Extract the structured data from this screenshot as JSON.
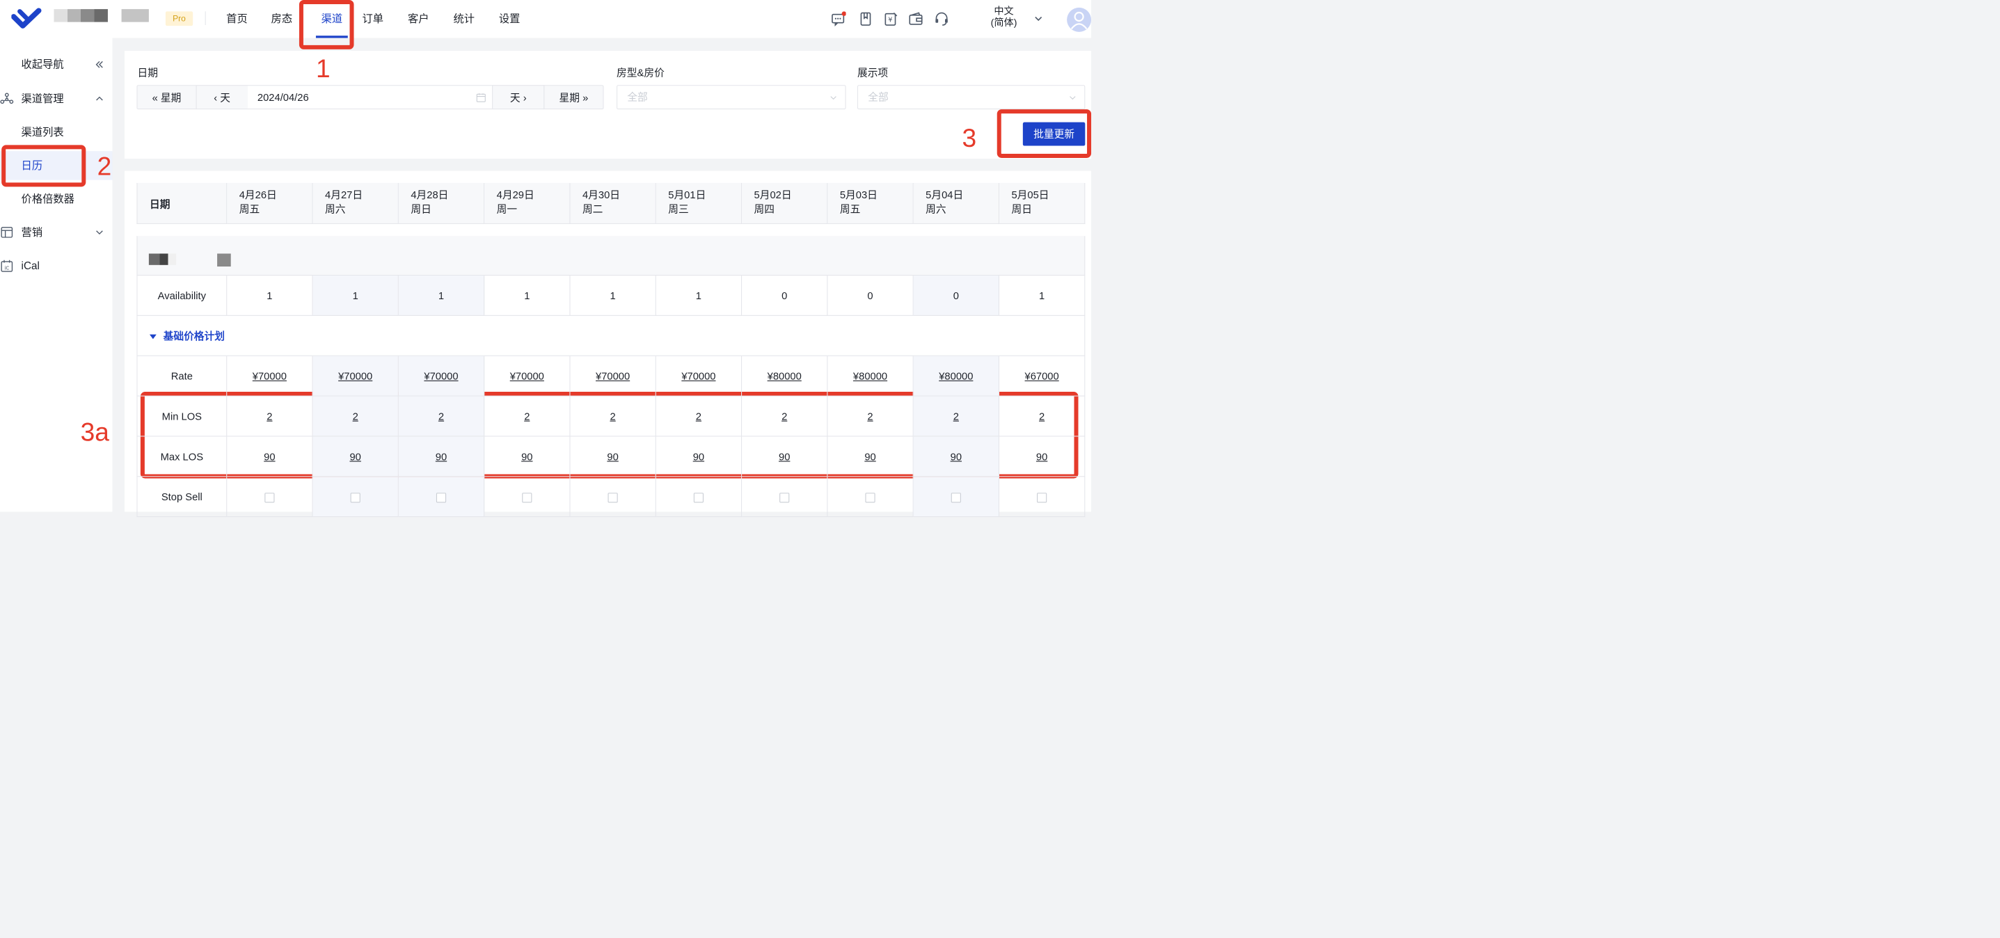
{
  "header": {
    "pro_badge": "Pro",
    "nav": [
      "首页",
      "房态",
      "渠道",
      "订单",
      "客户",
      "统计",
      "设置"
    ],
    "active_nav": "渠道",
    "lang_line1": "中文",
    "lang_line2": "(简体)"
  },
  "sidebar": {
    "collapse": "收起导航",
    "channel_mgmt": "渠道管理",
    "channel_list": "渠道列表",
    "calendar": "日历",
    "price_multiplier": "价格倍数器",
    "marketing": "营销",
    "ical": "iCal"
  },
  "filter": {
    "date_label": "日期",
    "prev_week": "星期",
    "prev_day": "天",
    "date_value": "2024/04/26",
    "next_day": "天",
    "next_week": "星期",
    "room_label": "房型&房价",
    "room_placeholder": "全部",
    "display_label": "展示项",
    "display_placeholder": "全部",
    "bulk_update": "批量更新"
  },
  "table": {
    "date_header": "日期",
    "columns": [
      {
        "date": "4月26日",
        "weekday": "周五"
      },
      {
        "date": "4月27日",
        "weekday": "周六"
      },
      {
        "date": "4月28日",
        "weekday": "周日"
      },
      {
        "date": "4月29日",
        "weekday": "周一"
      },
      {
        "date": "4月30日",
        "weekday": "周二"
      },
      {
        "date": "5月01日",
        "weekday": "周三"
      },
      {
        "date": "5月02日",
        "weekday": "周四"
      },
      {
        "date": "5月03日",
        "weekday": "周五"
      },
      {
        "date": "5月04日",
        "weekday": "周六"
      },
      {
        "date": "5月05日",
        "weekday": "周日"
      }
    ],
    "availability_label": "Availability",
    "availability": [
      "1",
      "1",
      "1",
      "1",
      "1",
      "1",
      "0",
      "0",
      "0",
      "1"
    ],
    "plan_name": "基础价格计划",
    "rate_label": "Rate",
    "rates": [
      "¥70000",
      "¥70000",
      "¥70000",
      "¥70000",
      "¥70000",
      "¥70000",
      "¥80000",
      "¥80000",
      "¥80000",
      "¥67000"
    ],
    "min_los_label": "Min LOS",
    "min_los": [
      "2",
      "2",
      "2",
      "2",
      "2",
      "2",
      "2",
      "2",
      "2",
      "2"
    ],
    "max_los_label": "Max LOS",
    "max_los": [
      "90",
      "90",
      "90",
      "90",
      "90",
      "90",
      "90",
      "90",
      "90",
      "90"
    ],
    "stop_sell_label": "Stop Sell"
  },
  "annotations": {
    "step1": "1",
    "step2": "2",
    "step3": "3",
    "step3a": "3a"
  },
  "colors": {
    "accent": "#1d43c9",
    "annotation_red": "#e53a2a"
  }
}
